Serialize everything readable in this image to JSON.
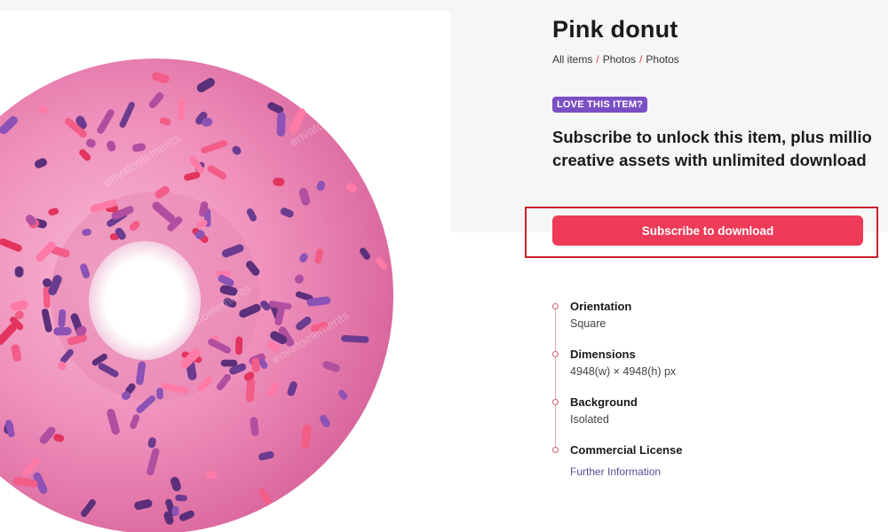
{
  "item": {
    "title": "Pink donut",
    "preview_alt": "Pink donut with sprinkles",
    "watermark": "envatoelements"
  },
  "breadcrumb": {
    "items": [
      "All items",
      "Photos",
      "Photos"
    ],
    "separator": "/"
  },
  "promo": {
    "badge": "LOVE THIS ITEM?",
    "line1": "Subscribe to unlock this item, plus millio",
    "line2": "creative assets with unlimited download"
  },
  "cta": {
    "label": "Subscribe to download"
  },
  "details": [
    {
      "label": "Orientation",
      "value": "Square"
    },
    {
      "label": "Dimensions",
      "value": "4948(w) × 4948(h) px"
    },
    {
      "label": "Background",
      "value": "Isolated"
    },
    {
      "label": "Commercial License",
      "link": "Further Information"
    }
  ],
  "colors": {
    "accent": "#ee3b58",
    "badge": "#7b4fc4",
    "highlight_border": "#c9202c",
    "link": "#5a4c9a"
  }
}
